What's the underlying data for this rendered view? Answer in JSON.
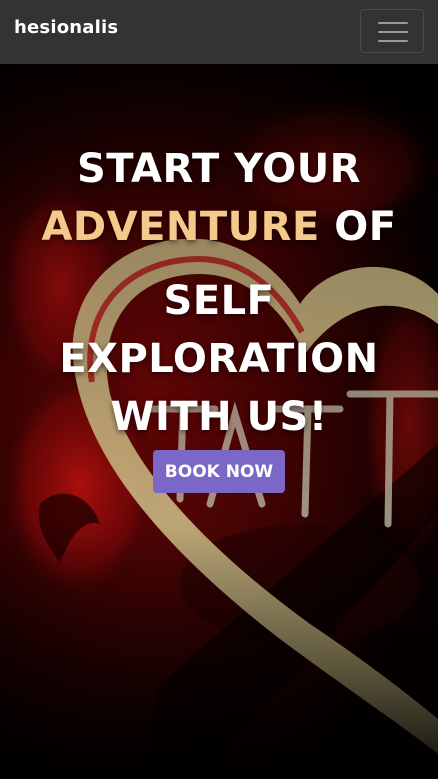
{
  "navbar": {
    "brand": "hesionalis",
    "menu_icon": "hamburger-menu-icon"
  },
  "hero": {
    "line1": "START YOUR",
    "line2_accent": "ADVENTURE",
    "line2_rest": " OF",
    "line3": "SELF",
    "line4": "EXPLORATION",
    "line5": "WITH US!",
    "button_label": "BOOK NOW"
  },
  "colors": {
    "navbar_bg": "#333333",
    "accent_text": "#f5c98c",
    "button_bg": "#7a67c8",
    "hero_red": "#c0100c"
  }
}
